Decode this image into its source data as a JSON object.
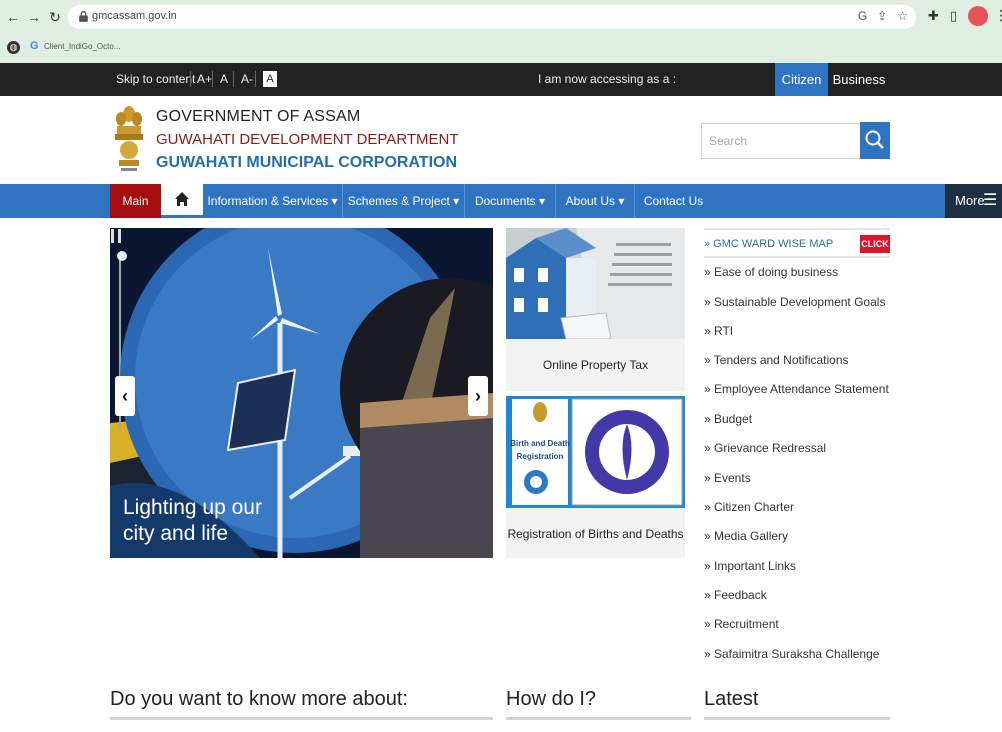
{
  "browser": {
    "url": "gmcassam.gov.in",
    "bookmark_label": "Client_IndiGo_Octo..."
  },
  "topbar": {
    "skip": "Skip to content",
    "font_plus": "A+",
    "font_normal": "A",
    "font_minus": "A-",
    "contrast": "A",
    "access_label": "I am now accessing as a :",
    "citizen": "Citizen",
    "business": "Business"
  },
  "header": {
    "gov": "GOVERNMENT OF ASSAM",
    "dept": "GUWAHATI DEVELOPMENT DEPARTMENT",
    "corp": "GUWAHATI MUNICIPAL CORPORATION",
    "search_placeholder": "Search"
  },
  "nav": {
    "main": "Main",
    "items": [
      "Information & Services ▾",
      "Schemes & Project ▾",
      "Documents ▾",
      "About Us ▾",
      "Contact Us"
    ],
    "more": "More"
  },
  "slider": {
    "caption_line1": "Lighting up our",
    "caption_line2": "city and life"
  },
  "cards": [
    {
      "label": "Online Property Tax"
    },
    {
      "label": "Registration of Births and Deaths",
      "img_text_1": "Birth and Death",
      "img_text_2": "Registration"
    }
  ],
  "right_links": {
    "map": "» GMC WARD WISE MAP",
    "click": "CLICK",
    "items": [
      "» Ease of doing business",
      "» Sustainable Development Goals",
      "» RTI",
      "» Tenders and Notifications",
      "» Employee Attendance Statement",
      "» Budget",
      "» Grievance Redressal",
      "» Events",
      "» Citizen Charter",
      "» Media Gallery",
      "» Important Links",
      "» Feedback",
      "» Recruitment",
      "» Safaimitra Suraksha Challenge"
    ]
  },
  "bottom": {
    "know_more": "Do you want to know more about:",
    "how_do_i": "How do I?",
    "latest": "Latest"
  },
  "colors": {
    "primary_blue": "#2f74c0",
    "main_red": "#a50e0e",
    "dark_bar": "#222222",
    "corp_blue": "#1f6fa8",
    "dept_red": "#8b1a1a"
  }
}
